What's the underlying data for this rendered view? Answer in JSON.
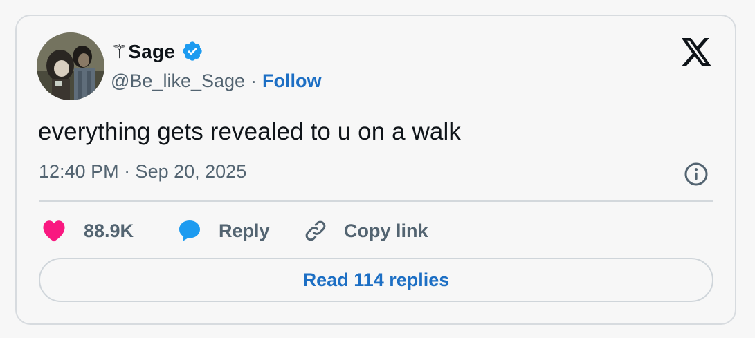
{
  "author": {
    "display_name": "⚚Sage",
    "handle": "@Be_like_Sage",
    "separator": "·",
    "follow_label": "Follow",
    "verified": true
  },
  "tweet": {
    "text": "everything gets revealed to u on a walk",
    "timestamp": "12:40 PM · Sep 20, 2025"
  },
  "actions": {
    "like_count": "88.9K",
    "reply_label": "Reply",
    "copy_link_label": "Copy link"
  },
  "read_replies_label": "Read 114 replies",
  "icons": {
    "logo": "x-logo-icon",
    "verified": "verified-badge-icon",
    "info": "info-icon",
    "like": "heart-icon",
    "reply": "speech-bubble-icon",
    "copy": "link-icon"
  },
  "colors": {
    "background": "#f7f7f7",
    "border": "#d7dbdf",
    "text_primary": "#0f1419",
    "text_secondary": "#536471",
    "link_blue": "#1d6fc4",
    "verified_blue": "#1d9bf0",
    "like_pink": "#f91880"
  }
}
